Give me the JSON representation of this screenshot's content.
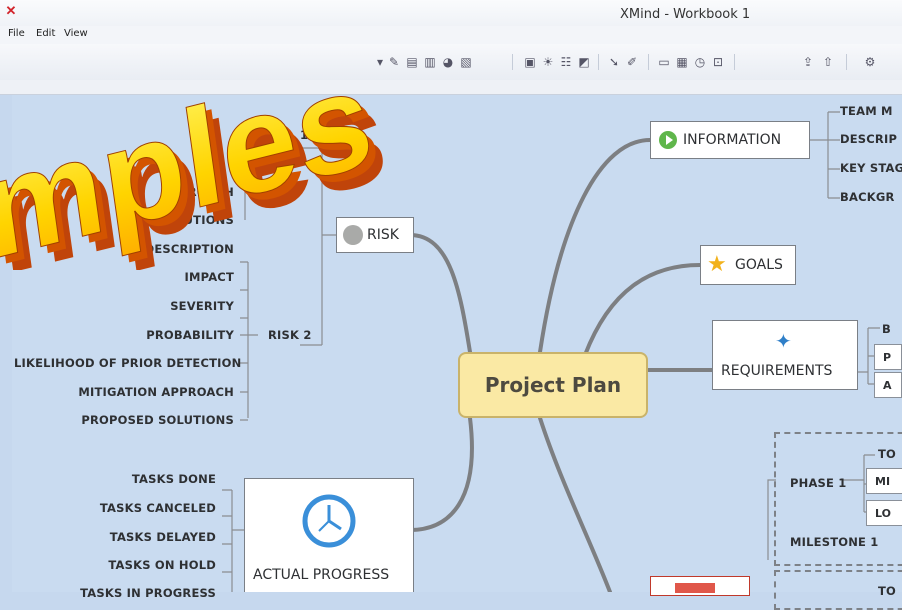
{
  "window": {
    "title": "XMind - Workbook 1",
    "app_icon": "xmind-logo-icon"
  },
  "menu": [
    "File",
    "Edit",
    "View"
  ],
  "toolbar_icons": [
    "dropdown-icon",
    "pencil-icon",
    "outline-icon",
    "notes-icon",
    "marker-icon",
    "layout-icon",
    "image-icon",
    "bulb-icon",
    "structure-icon",
    "theme-icon",
    "link-icon",
    "style-icon",
    "window-icon",
    "export-icon",
    "clock-icon",
    "zoom-icon",
    "share-icon",
    "upload-icon",
    "settings-icon"
  ],
  "overlay_text": "mples",
  "central": "Project Plan",
  "topics": {
    "information": "INFORMATION",
    "goals": "GOALS",
    "requirements": "REQUIREMENTS",
    "risk": "RISK",
    "actual_progress": "ACTUAL PROGRESS"
  },
  "information_items": [
    "TEAM M",
    "DESCRIP",
    "KEY STAG",
    "BACKGR"
  ],
  "requirements_items": [
    "B",
    "P",
    "A"
  ],
  "risk": {
    "risk1_label": "1",
    "risk1_items": [
      "ROACH",
      "OLUTIONS"
    ],
    "risk2_label": "RISK 2",
    "risk2_items": [
      "DESCRIPTION",
      "IMPACT",
      "SEVERITY",
      "PROBABILITY",
      "LIKELIHOOD OF PRIOR DETECTION",
      "MITIGATION APPROACH",
      "PROPOSED SOLUTIONS"
    ]
  },
  "progress_items": [
    "TASKS DONE",
    "TASKS CANCELED",
    "TASKS DELAYED",
    "TASKS ON HOLD",
    "TASKS IN PROGRESS"
  ],
  "phase": {
    "label": "PHASE 1",
    "items": [
      "TO",
      "MI",
      "LO"
    ],
    "milestone": "MILESTONE 1",
    "lower_item": "TO"
  },
  "colors": {
    "canvas": "#c9dbf0",
    "central_fill": "#fae9a4",
    "line": "#7d7f82",
    "wordart_fill": "#ffd400",
    "wordart_side": "#d35400"
  }
}
